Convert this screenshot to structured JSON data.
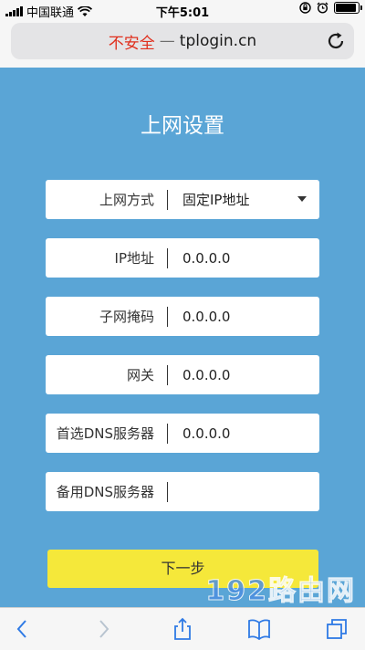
{
  "status_bar": {
    "carrier": "中国联通",
    "time": "下午5:01",
    "battery_level": 0.9,
    "icons": [
      "signal-icon",
      "wifi-icon",
      "orientation-lock-icon",
      "alarm-icon",
      "battery-icon"
    ]
  },
  "address_bar": {
    "insecure_label": "不安全",
    "separator": "—",
    "host": "tplogin.cn",
    "reload_icon": "reload-icon"
  },
  "page": {
    "title": "上网设置",
    "fields": [
      {
        "label": "上网方式",
        "value": "固定IP地址",
        "type": "select"
      },
      {
        "label": "IP地址",
        "value": "0.0.0.0"
      },
      {
        "label": "子网掩码",
        "value": "0.0.0.0"
      },
      {
        "label": "网关",
        "value": "0.0.0.0"
      },
      {
        "label": "首选DNS服务器",
        "value": "0.0.0.0"
      },
      {
        "label": "备用DNS服务器",
        "value": ""
      }
    ],
    "next_button": "下一步",
    "watermark": "192路由网"
  },
  "toolbar": {
    "icons": [
      "back-icon",
      "forward-icon",
      "share-icon",
      "bookmarks-icon",
      "tabs-icon"
    ]
  },
  "colors": {
    "background": "#5aa5d6",
    "button": "#f5e83a",
    "insecure": "#e0301e"
  }
}
